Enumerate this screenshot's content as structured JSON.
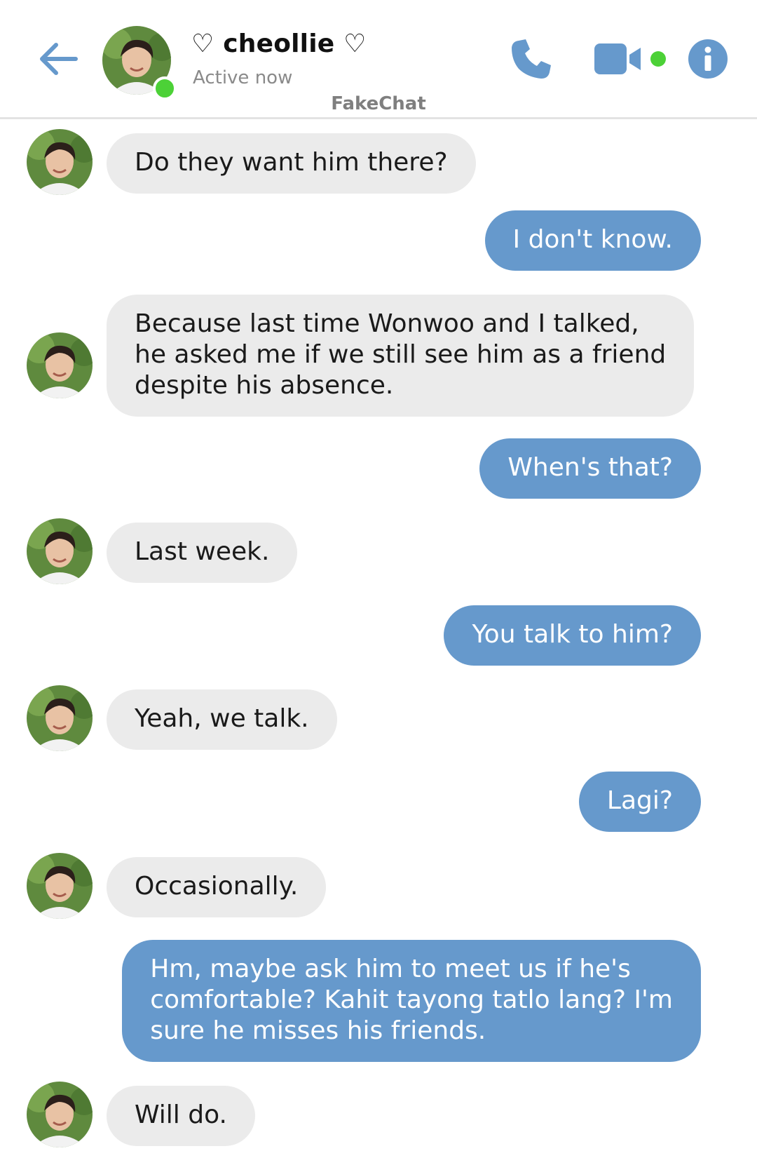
{
  "header": {
    "contact_name": "♡ cheollie ♡",
    "status": "Active now",
    "watermark": "FakeChat",
    "icons": [
      "back-arrow-icon",
      "phone-icon",
      "video-camera-icon",
      "info-icon"
    ]
  },
  "colors": {
    "accent": "#6699cc",
    "incoming_bubble": "#ebebeb",
    "online": "#4cd137"
  },
  "messages": [
    {
      "side": "incoming",
      "text": "Do they want him there?"
    },
    {
      "side": "outgoing",
      "text": "I don't know."
    },
    {
      "side": "incoming",
      "lines": [
        "Because last time Wonwoo and I talked,",
        "he asked me if we still see him as a friend",
        "despite his absence."
      ]
    },
    {
      "side": "outgoing",
      "text": "When's that?"
    },
    {
      "side": "incoming",
      "text": "Last week."
    },
    {
      "side": "outgoing",
      "text": "You talk to him?"
    },
    {
      "side": "incoming",
      "text": "Yeah, we talk."
    },
    {
      "side": "outgoing",
      "text": "Lagi?"
    },
    {
      "side": "incoming",
      "text": "Occasionally."
    },
    {
      "side": "outgoing",
      "lines": [
        "Hm, maybe ask him to meet us if he's",
        "comfortable? Kahit tayong tatlo lang? I'm",
        "sure he misses his friends."
      ]
    },
    {
      "side": "incoming",
      "text": "Will do."
    }
  ]
}
